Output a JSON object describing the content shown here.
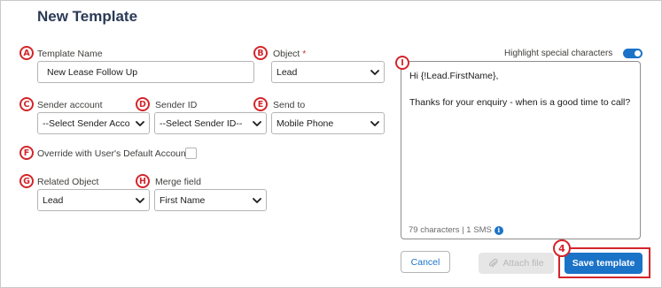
{
  "page": {
    "title": "New Template"
  },
  "markers": {
    "a": "A",
    "b": "B",
    "c": "C",
    "d": "D",
    "e": "E",
    "f": "F",
    "g": "G",
    "h": "H",
    "i": "I",
    "step": "4"
  },
  "form": {
    "template_name": {
      "label": "Template Name",
      "value": "New Lease Follow Up"
    },
    "object": {
      "label": "Object",
      "required_mark": "*",
      "value": "Lead"
    },
    "sender_account": {
      "label": "Sender account",
      "value": "--Select Sender Account--"
    },
    "sender_id": {
      "label": "Sender ID",
      "value": "--Select Sender ID--"
    },
    "send_to": {
      "label": "Send to",
      "value": "Mobile Phone"
    },
    "override": {
      "label": "Override with User's Default Account:",
      "checked": false
    },
    "related_object": {
      "label": "Related Object",
      "value": "Lead"
    },
    "merge_field": {
      "label": "Merge field",
      "value": "First Name"
    }
  },
  "message": {
    "highlight_label": "Highlight special characters",
    "highlight_on": true,
    "line1": "Hi {!Lead.FirstName},",
    "line2": "Thanks for your enquiry - when is a good time to call?",
    "counter": "79 characters | 1 SMS",
    "info_glyph": "i"
  },
  "actions": {
    "cancel_label": "Cancel",
    "attach_label": "Attach file",
    "save_label": "Save template"
  },
  "colors": {
    "accent": "#1b73c8",
    "marker": "#d4252b"
  }
}
